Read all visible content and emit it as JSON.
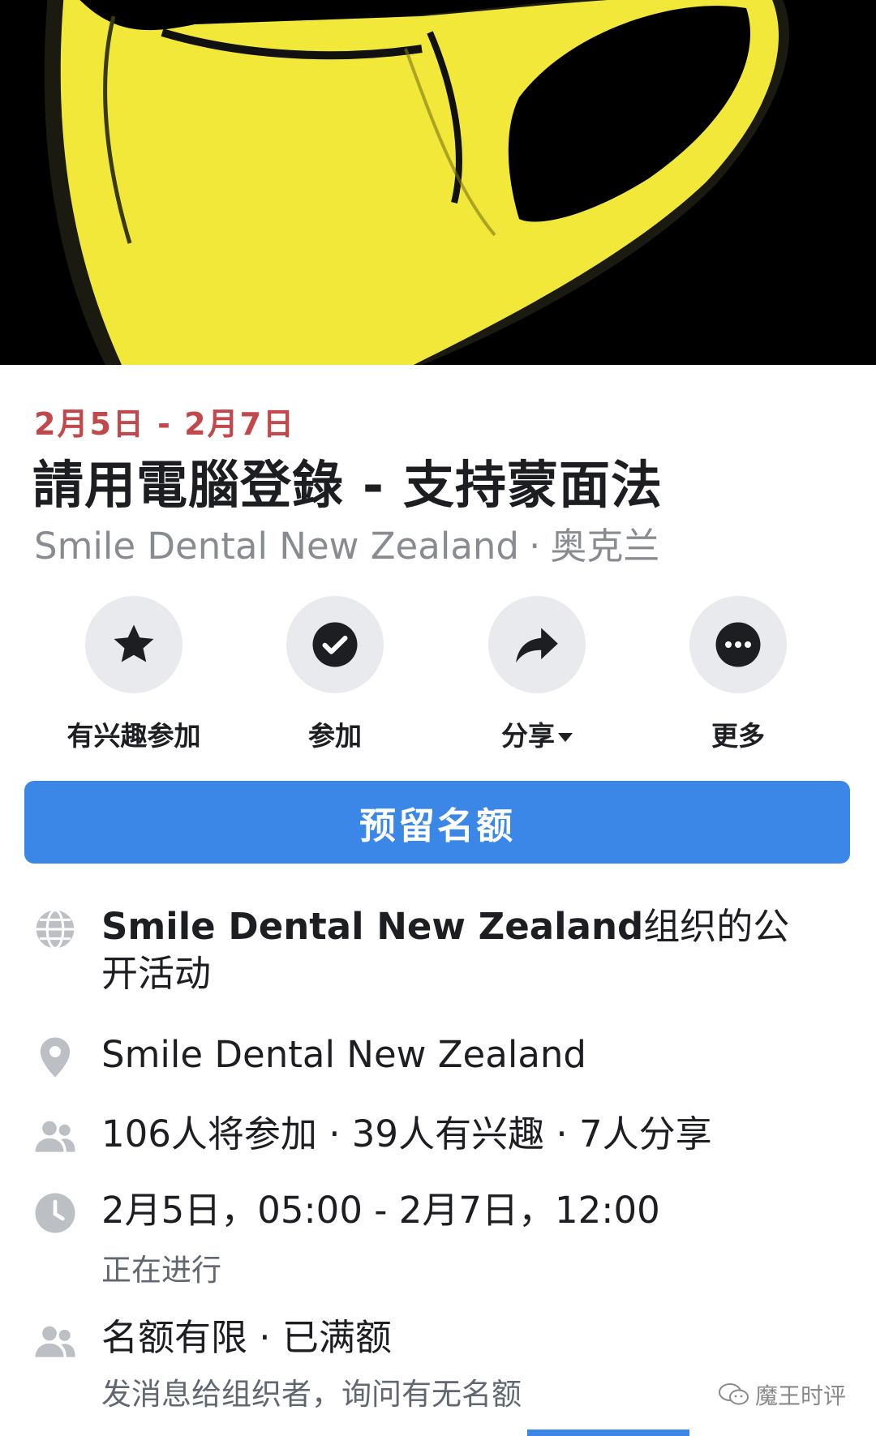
{
  "cover": {
    "description_icon": "yellow-face-mask-image",
    "background": "#000000",
    "mask_color": "#f2e83a"
  },
  "event": {
    "date_range": "2月5日 - 2月7日",
    "title": "請用電腦登錄 - 支持蒙面法",
    "host": "Smile Dental New Zealand",
    "separator": "·",
    "location": "奥克兰"
  },
  "actions": [
    {
      "label": "有兴趣参加",
      "icon": "star-icon"
    },
    {
      "label": "参加",
      "icon": "check-circle-icon"
    },
    {
      "label": "分享",
      "icon": "share-arrow-icon"
    },
    {
      "label": "更多",
      "icon": "more-dots-icon"
    }
  ],
  "reserve_button": {
    "label": "预留名额",
    "color": "#3b87e8"
  },
  "info": {
    "organizer_bold": "Smile Dental New Zealand",
    "organizer_suffix": "组织的公开活动",
    "place": "Smile Dental New Zealand",
    "attendance": "106人将参加 · 39人有兴趣 · 7人分享",
    "time": "2月5日，05:00 - 2月7日，12:00",
    "time_status": "正在进行",
    "capacity": "名额有限 · 已满额",
    "capacity_hint": "发消息给组织者，询问有无名额"
  },
  "watermark": {
    "text": "魔王时评"
  },
  "colors": {
    "date_red": "#c2484c",
    "icon_gray": "#bcc0c4",
    "primary_blue": "#3b87e8"
  }
}
